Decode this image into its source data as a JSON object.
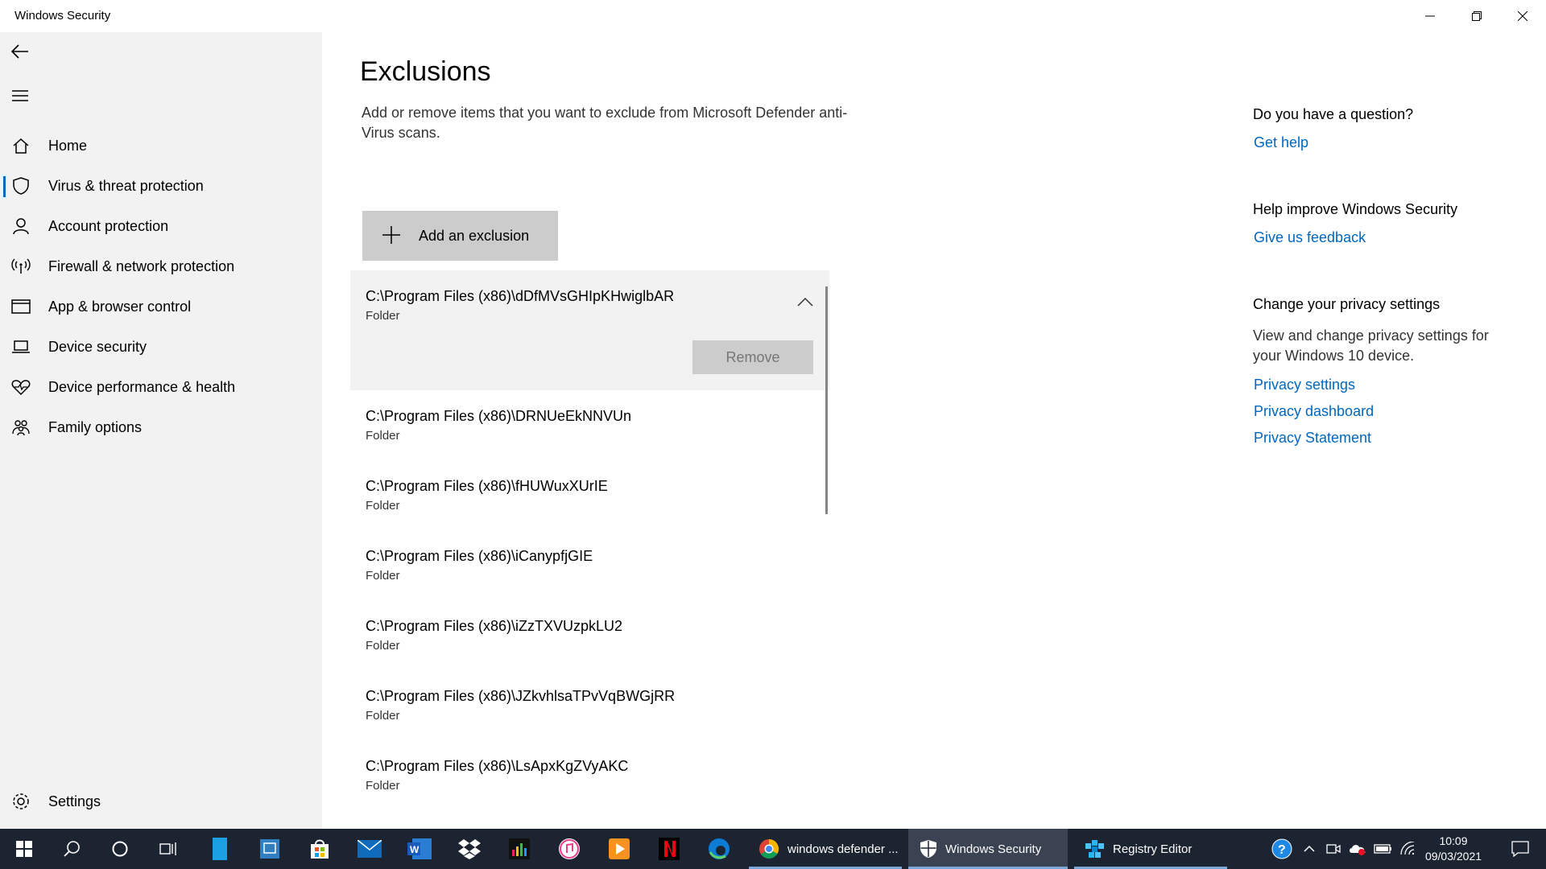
{
  "window": {
    "title": "Windows Security",
    "controls": {
      "minimize": "minimize-icon",
      "maximize": "restore-icon",
      "close": "close-icon"
    }
  },
  "sidebar": {
    "back_icon": "back-arrow-icon",
    "menu_icon": "hamburger-icon",
    "items": [
      {
        "label": "Home",
        "icon": "home-icon"
      },
      {
        "label": "Virus & threat protection",
        "icon": "shield-icon",
        "active": true
      },
      {
        "label": "Account protection",
        "icon": "person-icon"
      },
      {
        "label": "Firewall & network protection",
        "icon": "wireless-icon"
      },
      {
        "label": "App & browser control",
        "icon": "browser-window-icon"
      },
      {
        "label": "Device security",
        "icon": "laptop-icon"
      },
      {
        "label": "Device performance & health",
        "icon": "heart-pulse-icon"
      },
      {
        "label": "Family options",
        "icon": "family-icon"
      }
    ],
    "settings": {
      "label": "Settings",
      "icon": "gear-icon"
    }
  },
  "main": {
    "title": "Exclusions",
    "description": "Add or remove items that you want to exclude from Microsoft Defender anti-Virus scans.",
    "add_button": {
      "label": "Add an exclusion",
      "icon": "plus-icon"
    },
    "remove_label": "Remove",
    "exclusions": [
      {
        "path": "C:\\Program Files (x86)\\dDfMVsGHIpKHwiglbAR",
        "type": "Folder",
        "expanded": true
      },
      {
        "path": "C:\\Program Files (x86)\\DRNUeEkNNVUn",
        "type": "Folder"
      },
      {
        "path": "C:\\Program Files (x86)\\fHUWuxXUrIE",
        "type": "Folder"
      },
      {
        "path": "C:\\Program Files (x86)\\iCanypfjGIE",
        "type": "Folder"
      },
      {
        "path": "C:\\Program Files (x86)\\iZzTXVUzpkLU2",
        "type": "Folder"
      },
      {
        "path": "C:\\Program Files (x86)\\JZkvhlsaTPvVqBWGjRR",
        "type": "Folder"
      },
      {
        "path": "C:\\Program Files (x86)\\LsApxKgZVyAKC",
        "type": "Folder"
      }
    ]
  },
  "right_panel": {
    "question_heading": "Do you have a question?",
    "get_help": "Get help",
    "improve_heading": "Help improve Windows Security",
    "feedback": "Give us feedback",
    "privacy_heading": "Change your privacy settings",
    "privacy_text": "View and change privacy settings for your Windows 10 device.",
    "privacy_links": [
      "Privacy settings",
      "Privacy dashboard",
      "Privacy Statement"
    ]
  },
  "taskbar": {
    "pinned": [
      "windows-start-icon",
      "search-icon",
      "cortana-icon",
      "task-view-icon",
      "file-explorer-icon",
      "snipping-icon",
      "store-icon",
      "mail-icon",
      "word-icon",
      "dropbox-icon",
      "audio-app-icon",
      "itunes-icon",
      "media-player-icon",
      "netflix-icon",
      "edge-icon"
    ],
    "windows": [
      {
        "label": "windows defender ...",
        "icon": "chrome-icon"
      },
      {
        "label": "Windows Security",
        "icon": "windows-security-icon",
        "active": true
      },
      {
        "label": "Registry Editor",
        "icon": "registry-editor-icon"
      }
    ],
    "tray": [
      "help-icon",
      "chevron-up-icon",
      "meet-now-icon",
      "onedrive-icon",
      "battery-icon",
      "wifi-icon"
    ],
    "time": "10:09",
    "date": "09/03/2021",
    "notification_icon": "action-center-icon"
  }
}
